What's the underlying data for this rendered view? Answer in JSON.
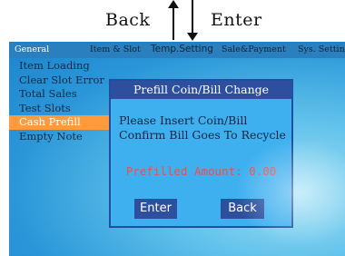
{
  "hints": {
    "back": "Back",
    "enter": "Enter"
  },
  "menu": {
    "tabs": [
      "General",
      "Item & Slot",
      "Temp.Setting",
      "Sale&Payment",
      "Sys. Setting"
    ],
    "active_tab": "General"
  },
  "sidebar": {
    "items": [
      "Item Loading",
      "Clear Slot Error",
      "Total Sales",
      "Test Slots",
      "Cash Prefill",
      "Empty Note"
    ],
    "active_item": "Cash Prefill"
  },
  "dialog": {
    "title": "Prefill Coin/Bill Change",
    "line1": "Please Insert Coin/Bill",
    "line2": "Confirm Bill Goes To Recycle",
    "amount_text": "Prefilled Amount: 0.00",
    "enter_label": "Enter",
    "back_label": "Back"
  },
  "colors": {
    "menu_bar": "#2a7fbf",
    "active_side_item": "#ff9b3d",
    "dialog_bg": "#3fb0ef",
    "dialog_title": "#2d4f9e",
    "amount_text": "#e9504a"
  }
}
